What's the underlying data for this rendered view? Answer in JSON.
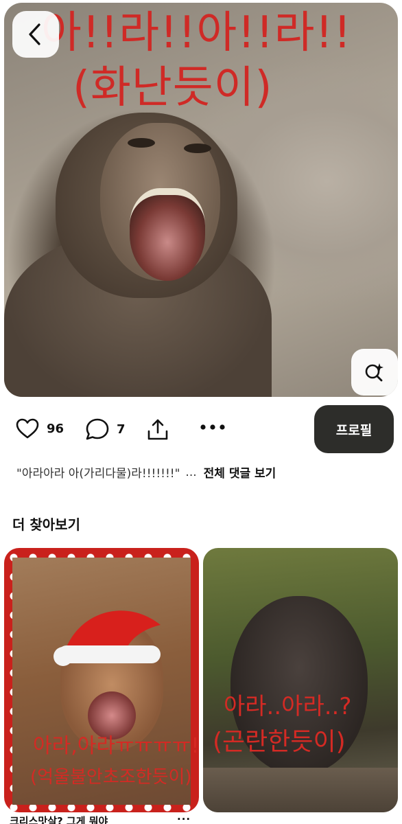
{
  "hero": {
    "caption_line1": "아!!라!!아!!라!!",
    "caption_line2": "(화난듯이)"
  },
  "icons": {
    "back": "chevron-left-icon",
    "visual_search": "lens-sparkle-icon",
    "like": "heart-icon",
    "comment": "speech-bubble-icon",
    "share": "share-upload-icon",
    "more": "more-dots-icon"
  },
  "actions": {
    "like_count": "96",
    "comment_count": "7",
    "more_label": "•••",
    "profile_label": "프로필"
  },
  "comment_preview": {
    "text": "\"아라아라 아(가리다물)라!!!!!!!\"",
    "ellipsis": "...",
    "view_all_label": "전체 댓글 보기"
  },
  "section": {
    "title": "더 찾아보기"
  },
  "cards": [
    {
      "caption_a": "아라,아라ㅠㅠㅠㅠ!!",
      "caption_b": "(억울불안초조한듯이)",
      "title": "크리스맛살? 그게 뭐야",
      "more_label": "···"
    },
    {
      "caption_a": "아라..아라..?",
      "caption_b": "(곤란한듯이)"
    }
  ],
  "colors": {
    "caption_red": "#cf2a26",
    "profile_button_bg": "#2d2d2a",
    "card_border_red": "#c9211c"
  }
}
